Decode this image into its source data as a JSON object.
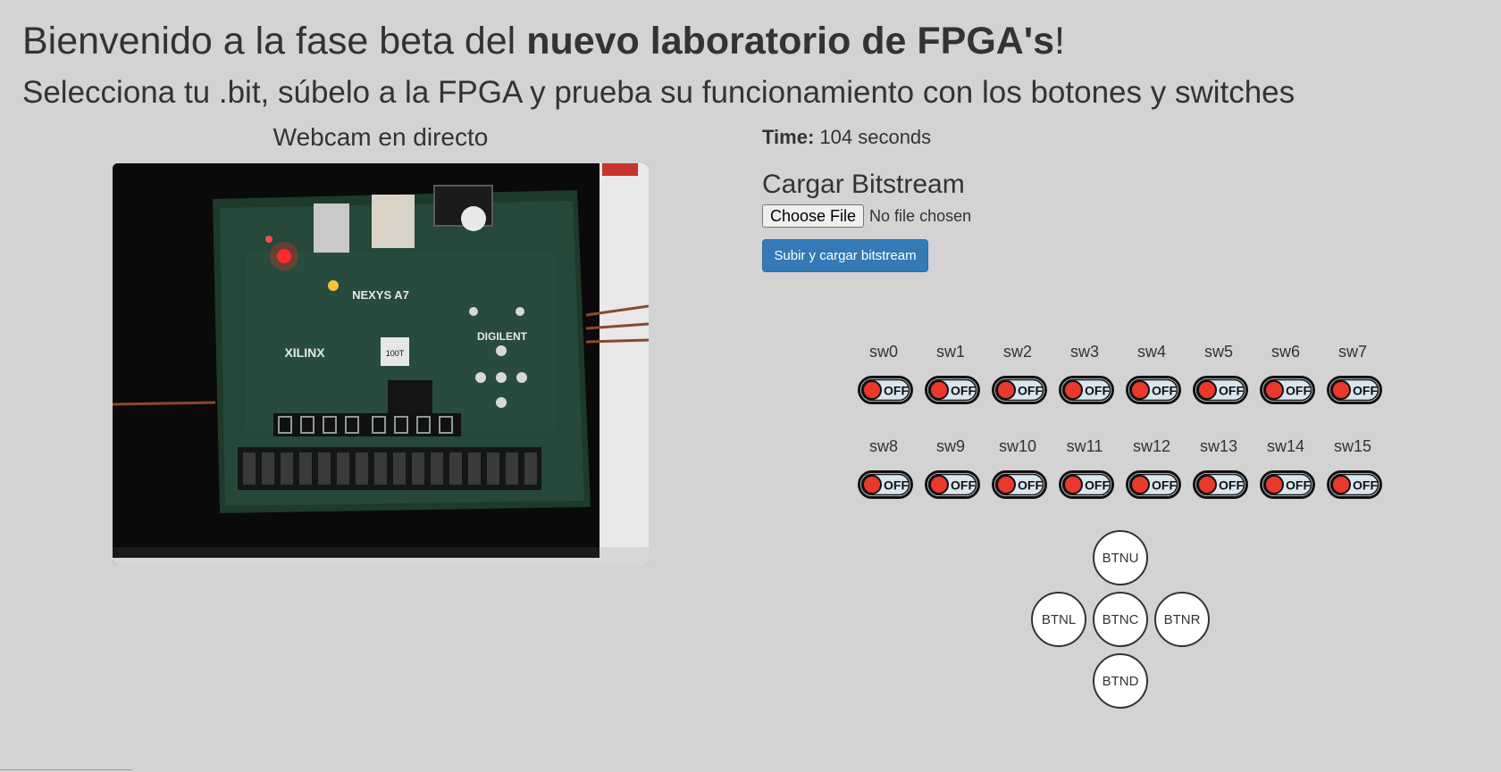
{
  "header": {
    "title_prefix": "Bienvenido a la fase beta del ",
    "title_bold": "nuevo laboratorio de FPGA's",
    "title_suffix": "!",
    "subtitle": "Selecciona tu .bit, súbelo a la FPGA y prueba su funcionamiento con los botones y switches"
  },
  "webcam": {
    "title": "Webcam en directo",
    "board_model": "NEXYS A7",
    "brand_left": "XILINX",
    "brand_right": "DIGILENT",
    "chip_label": "100T"
  },
  "timer": {
    "label": "Time:",
    "value": "104 seconds"
  },
  "upload": {
    "title": "Cargar Bitstream",
    "choose_label": "Choose File",
    "file_status": "No file chosen",
    "submit_label": "Subir y cargar bitstream"
  },
  "switches": [
    {
      "label": "sw0",
      "state": "OFF"
    },
    {
      "label": "sw1",
      "state": "OFF"
    },
    {
      "label": "sw2",
      "state": "OFF"
    },
    {
      "label": "sw3",
      "state": "OFF"
    },
    {
      "label": "sw4",
      "state": "OFF"
    },
    {
      "label": "sw5",
      "state": "OFF"
    },
    {
      "label": "sw6",
      "state": "OFF"
    },
    {
      "label": "sw7",
      "state": "OFF"
    },
    {
      "label": "sw8",
      "state": "OFF"
    },
    {
      "label": "sw9",
      "state": "OFF"
    },
    {
      "label": "sw10",
      "state": "OFF"
    },
    {
      "label": "sw11",
      "state": "OFF"
    },
    {
      "label": "sw12",
      "state": "OFF"
    },
    {
      "label": "sw13",
      "state": "OFF"
    },
    {
      "label": "sw14",
      "state": "OFF"
    },
    {
      "label": "sw15",
      "state": "OFF"
    }
  ],
  "buttons": {
    "up": "BTNU",
    "left": "BTNL",
    "center": "BTNC",
    "right": "BTNR",
    "down": "BTND"
  },
  "colors": {
    "background": "#d3d3d3",
    "primary": "#337ab7",
    "switch_off_knob": "#e8392c"
  }
}
